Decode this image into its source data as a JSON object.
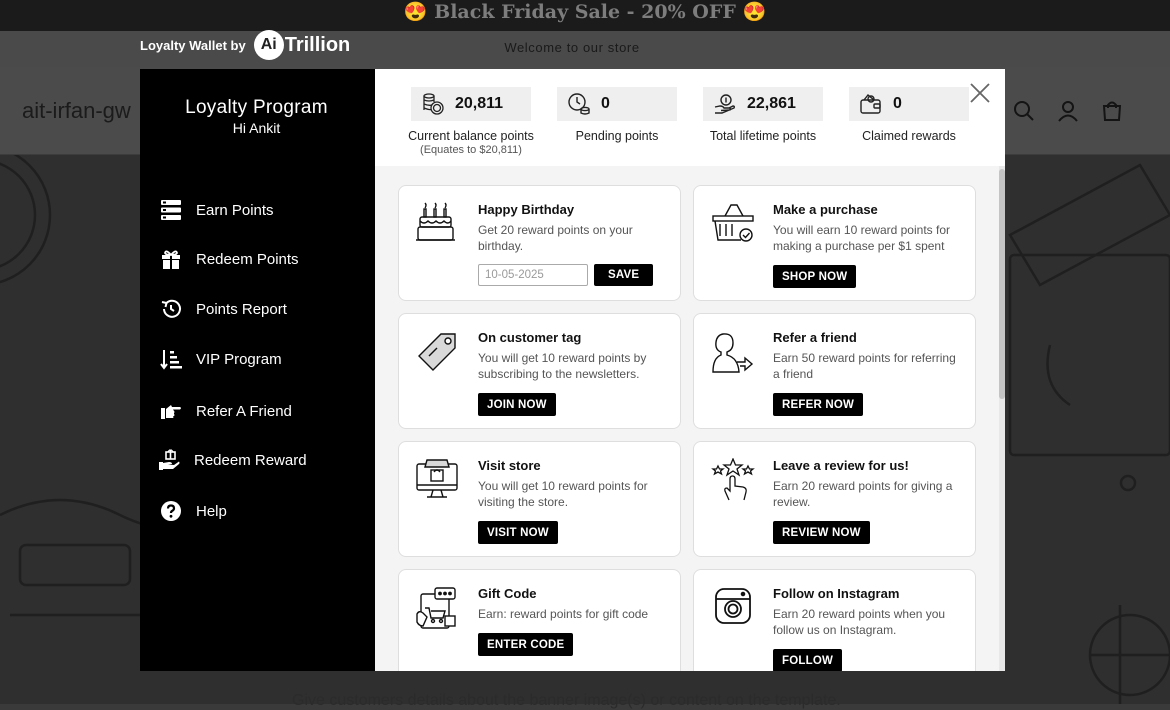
{
  "store": {
    "announcement": "Black Friday Sale - 20% OFF",
    "announcement_emoji": "😍",
    "welcome": "Welcome to our store",
    "name": "ait-irfan-gw",
    "hero_text": "Give customers details about the banner image(s) or content on the template."
  },
  "brand": {
    "label": "Loyalty Wallet by",
    "logo_ai": "Ai",
    "logo_trillion": "Trillion"
  },
  "sidebar": {
    "title": "Loyalty Program",
    "greeting": "Hi Ankit",
    "items": [
      {
        "label": "Earn Points",
        "icon": "list-icon"
      },
      {
        "label": "Redeem Points",
        "icon": "gift-icon"
      },
      {
        "label": "Points Report",
        "icon": "history-icon"
      },
      {
        "label": "VIP Program",
        "icon": "sort-icon"
      },
      {
        "label": "Refer A Friend",
        "icon": "pointing-hand-icon"
      },
      {
        "label": "Redeem Reward",
        "icon": "hand-gift-icon"
      },
      {
        "label": "Help",
        "icon": "question-icon"
      }
    ]
  },
  "stats": [
    {
      "value": "20,811",
      "label": "Current balance points",
      "note": "(Equates to $20,811)",
      "icon": "coins-icon"
    },
    {
      "value": "0",
      "label": "Pending points",
      "icon": "clock-coins-icon"
    },
    {
      "value": "22,861",
      "label": "Total lifetime points",
      "icon": "hand-coin-icon"
    },
    {
      "value": "0",
      "label": "Claimed rewards",
      "icon": "wallet-icon"
    }
  ],
  "cards": [
    {
      "title": "Happy Birthday",
      "desc": "Get 20 reward points on your birthday.",
      "input_value": "10-05-2025",
      "button": "SAVE",
      "icon": "birthday-cake-icon"
    },
    {
      "title": "Make a purchase",
      "desc": "You will earn 10 reward points for making a purchase per $1 spent",
      "button": "SHOP NOW",
      "icon": "basket-icon"
    },
    {
      "title": "On customer tag",
      "desc": "You will get 10 reward points by subscribing to the newsletters.",
      "button": "JOIN NOW",
      "icon": "tag-icon"
    },
    {
      "title": "Refer a friend",
      "desc": "Earn 50 reward points for referring a friend",
      "button": "REFER NOW",
      "icon": "refer-person-icon"
    },
    {
      "title": "Visit store",
      "desc": "You will get 10 reward points for visiting the store.",
      "button": "VISIT NOW",
      "icon": "store-monitor-icon"
    },
    {
      "title": "Leave a review for us!",
      "desc": "Earn 20 reward points for giving a review.",
      "button": "REVIEW NOW",
      "icon": "review-stars-icon"
    },
    {
      "title": "Gift Code",
      "desc": "Earn: reward points for gift code",
      "button": "ENTER CODE",
      "icon": "gift-code-icon"
    },
    {
      "title": "Follow on Instagram",
      "desc": "Earn 20 reward points when you follow us on Instagram.",
      "button": "FOLLOW",
      "icon": "instagram-icon"
    }
  ]
}
